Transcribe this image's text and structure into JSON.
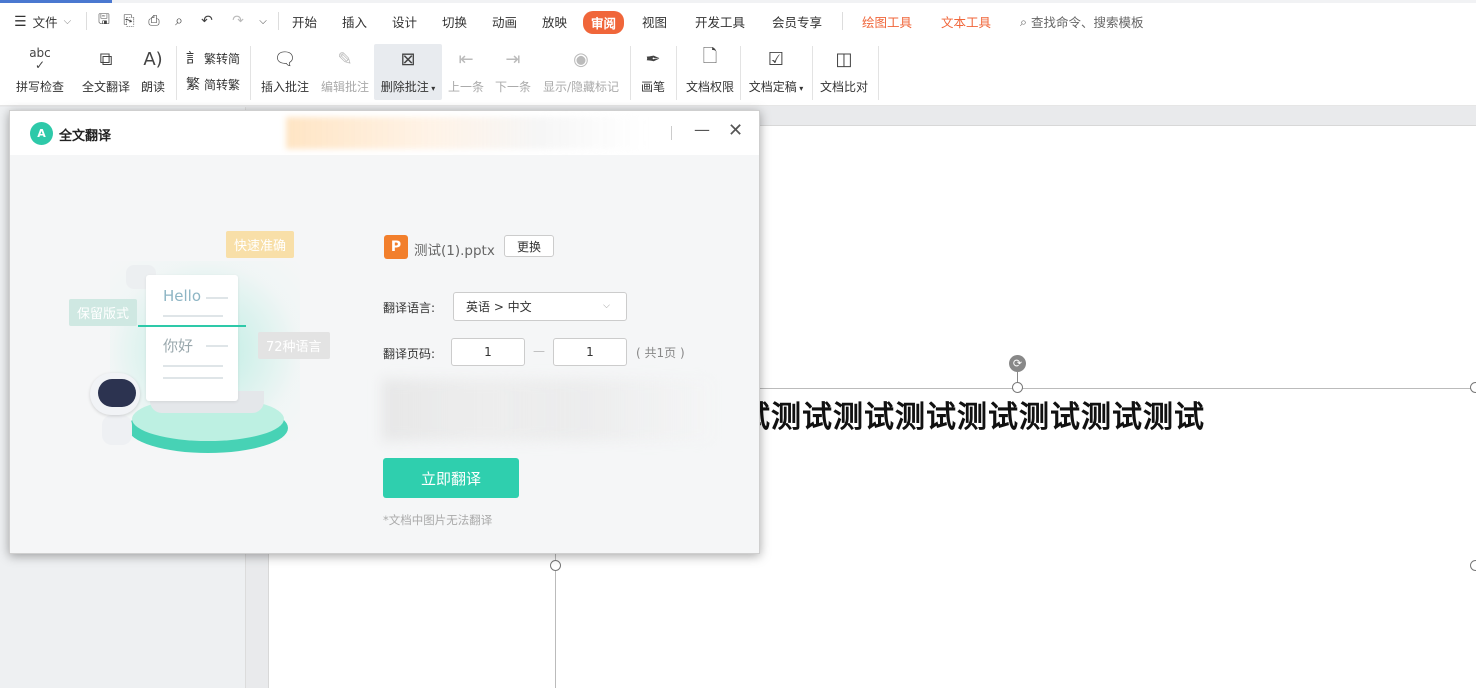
{
  "menubar": {
    "file_label": "文件",
    "tabs": [
      "开始",
      "插入",
      "设计",
      "切换",
      "动画",
      "放映",
      "审阅",
      "视图",
      "开发工具",
      "会员专享"
    ],
    "active_tab": "审阅",
    "tool_tabs": [
      "绘图工具",
      "文本工具"
    ],
    "search_placeholder": "查找命令、搜索模板",
    "accent_color": "#f0663a"
  },
  "ribbon": {
    "spellcheck": "拼写检查",
    "full_translate": "全文翻译",
    "read_aloud": "朗读",
    "trad_to_simp": "繁转简",
    "simp_to_trad": "简转繁",
    "insert_comment": "插入批注",
    "edit_comment": "编辑批注",
    "delete_comment": "删除批注",
    "prev": "上一条",
    "next": "下一条",
    "show_hide_marks": "显示/隐藏标记",
    "pen": "画笔",
    "doc_permission": "文档权限",
    "doc_finalize": "文档定稿",
    "doc_compare": "文档比对",
    "spell_icon_text": "abc"
  },
  "slide": {
    "text": "试测试测试测试测试测试测试测试"
  },
  "dialog": {
    "title": "全文翻译",
    "logo_text": "A",
    "file_name": "测试(1).pptx",
    "change_label": "更换",
    "lang_label": "翻译语言:",
    "lang_value": "英语 > 中文",
    "page_label": "翻译页码:",
    "page_from": "1",
    "page_to": "1",
    "page_total": "( 共1页 )",
    "translate_button": "立即翻译",
    "note": "*文档中图片无法翻译",
    "illustration": {
      "bubble_fast": "快速准确",
      "bubble_layout": "保留版式",
      "bubble_langs": "72种语言",
      "hello": "Hello",
      "nihao": "你好"
    },
    "brand_color": "#2fcfae"
  }
}
